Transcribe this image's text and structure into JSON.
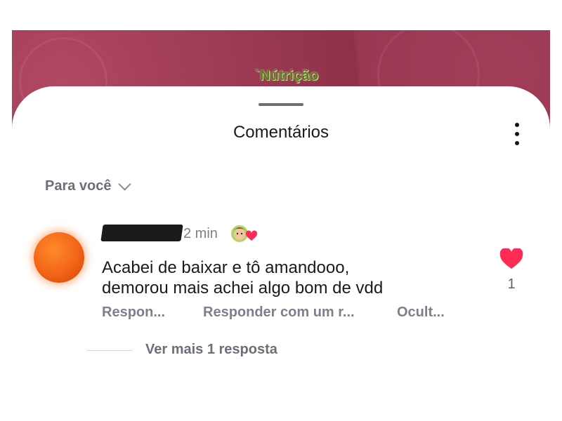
{
  "header": {
    "brand_text": "`Nútrição"
  },
  "sheet": {
    "title": "Comentários",
    "sort_label": "Para você"
  },
  "comment": {
    "timestamp": "2 min",
    "text_line1": "Acabei de baixar e tô amandooo,",
    "text_line2": "demorou mais achei algo bom de vdd",
    "actions": {
      "reply": "Respon...",
      "reply_with": "Responder com um r...",
      "hide": "Ocult..."
    },
    "like_count": "1"
  },
  "replies": {
    "view_more": "Ver mais 1 resposta"
  },
  "colors": {
    "header_bg": "#8f3149",
    "brand_green": "#5a7a1f",
    "like_red": "#fe2c55",
    "muted_text": "#7c808a",
    "avatar_orange": "#f26418"
  },
  "icons": [
    "more-vertical-icon",
    "chevron-down-icon",
    "heart-icon",
    "sticker-badge-icon"
  ]
}
